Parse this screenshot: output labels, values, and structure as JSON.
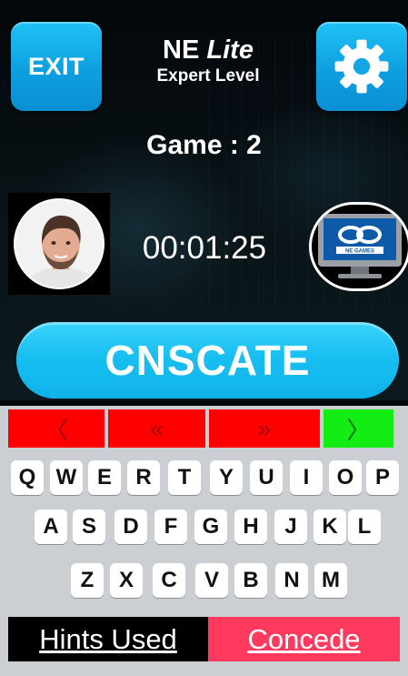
{
  "header": {
    "exit_label": "EXIT",
    "title_main": "NE",
    "title_italic": "Lite",
    "title_sub": "Expert Level"
  },
  "game": {
    "label": "Game : 2",
    "timer": "00:01:25",
    "word": "CNSCATE",
    "opponent_logo_text": "NE GAMES"
  },
  "nav": {
    "first": "〈",
    "prev": "«",
    "next": "»",
    "last": "〉"
  },
  "keyboard": {
    "row1": [
      "Q",
      "W",
      "E",
      "R",
      "T",
      "Y",
      "U",
      "I",
      "O",
      "P"
    ],
    "row2": [
      "A",
      "S",
      "D",
      "F",
      "G",
      "H",
      "J",
      "K",
      "L"
    ],
    "row3": [
      "Z",
      "X",
      "C",
      "V",
      "B",
      "N",
      "M"
    ]
  },
  "footer": {
    "hints_label": "Hints Used",
    "concede_label": "Concede"
  },
  "colors": {
    "accent_blue": "#18bff1",
    "nav_red": "#ff0000",
    "nav_green": "#13ed13",
    "concede": "#ff3a5e"
  },
  "icons": {
    "settings": "gear-icon",
    "avatar": "player-avatar",
    "opponent": "computer-monitor-icon"
  }
}
